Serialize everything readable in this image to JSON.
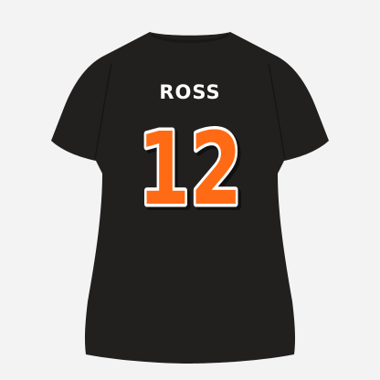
{
  "product": {
    "player_name": "ROSS",
    "player_number": "12"
  },
  "colors": {
    "background": "#f3f3f3",
    "shirt": "#221f1f",
    "number_fill": "#ff6a14",
    "number_outline": "#ffffff",
    "number_shadow": "#111111",
    "name_fill": "#ffffff"
  }
}
